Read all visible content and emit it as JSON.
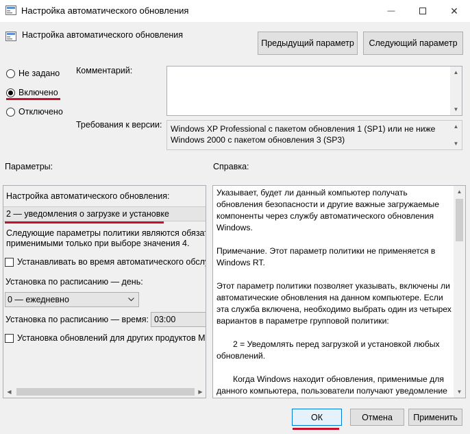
{
  "window": {
    "title": "Настройка автоматического обновления",
    "minimize_glyph": "—",
    "maximize_glyph": "☐",
    "close_glyph": "✕"
  },
  "header": {
    "title": "Настройка автоматического обновления",
    "prev_button": "Предыдущий параметр",
    "next_button": "Следующий параметр"
  },
  "state": {
    "options": [
      {
        "label": "Не задано",
        "checked": false
      },
      {
        "label": "Включено",
        "checked": true
      },
      {
        "label": "Отключено",
        "checked": false
      }
    ]
  },
  "comment": {
    "label": "Комментарий:",
    "value": ""
  },
  "requirements": {
    "label": "Требования к версии:",
    "lines": [
      "Windows XP Professional с пакетом обновления 1 (SP1) или не ниже",
      "Windows 2000 с пакетом обновления 3 (SP3)"
    ]
  },
  "params": {
    "heading": "Параметры:",
    "setting_label": "Настройка автоматического обновления:",
    "setting_value": "2 — уведомления о загрузке и установке",
    "note_lines": [
      "Следующие параметры политики являются обязател",
      "применимыми только при выборе значения 4."
    ],
    "install_maintenance_label": "Устанавливать во время автоматического обслуж",
    "day_label": "Установка по расписанию — день:",
    "day_value": "0 — ежедневно",
    "time_label": "Установка по расписанию — время:",
    "time_value": "03:00",
    "other_products_label": "Установка обновлений для других продуктов Майк"
  },
  "help": {
    "heading": "Справка:",
    "paragraphs": [
      "Указывает, будет ли данный компьютер получать обновления безопасности и другие важные загружаемые компоненты через службу автоматического обновления Windows.",
      "Примечание. Этот параметр политики не применяется в Windows RT.",
      "Этот параметр политики позволяет указывать, включены ли автоматические обновления на данном компьютере. Если эта служба включена, необходимо выбрать один из четырех вариантов в параметре групповой политики:",
      "2 = Уведомлять перед загрузкой и установкой любых обновлений.",
      "Когда Windows находит обновления, применимые для данного компьютера, пользователи получают уведомление о готовности обновлений к загрузке. После перехода в Центр обновления Windows пользователи могут загрузить и"
    ]
  },
  "footer": {
    "ok": "ОК",
    "cancel": "Отмена",
    "apply": "Применить"
  },
  "colors": {
    "accent_red": "#c8102e",
    "ok_focus": "#0078d7"
  }
}
